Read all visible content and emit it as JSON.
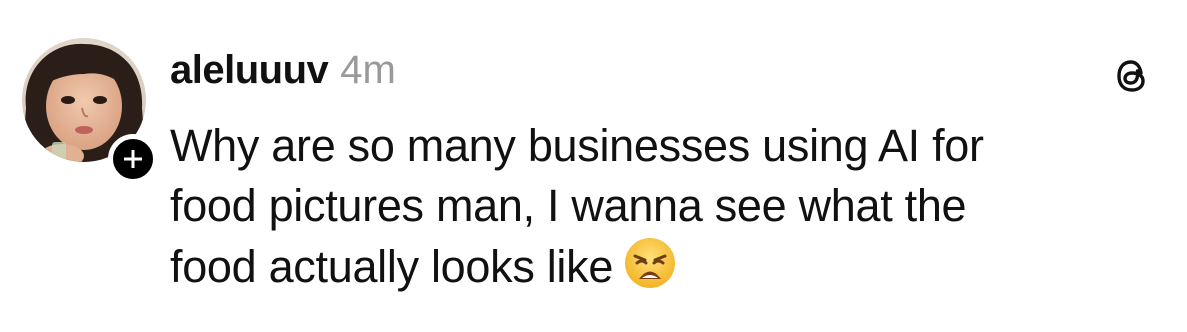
{
  "post": {
    "author": {
      "username": "aleluuuv",
      "timestamp": "4m",
      "avatar_icon": "profile-photo",
      "follow_icon": "plus-icon"
    },
    "app_icon": "threads-logo-icon",
    "text_lines": [
      "Why are so many businesses using AI for",
      "food pictures man, I wanna see what the",
      "food actually looks like"
    ],
    "emoji": "weary-face-emoji"
  }
}
